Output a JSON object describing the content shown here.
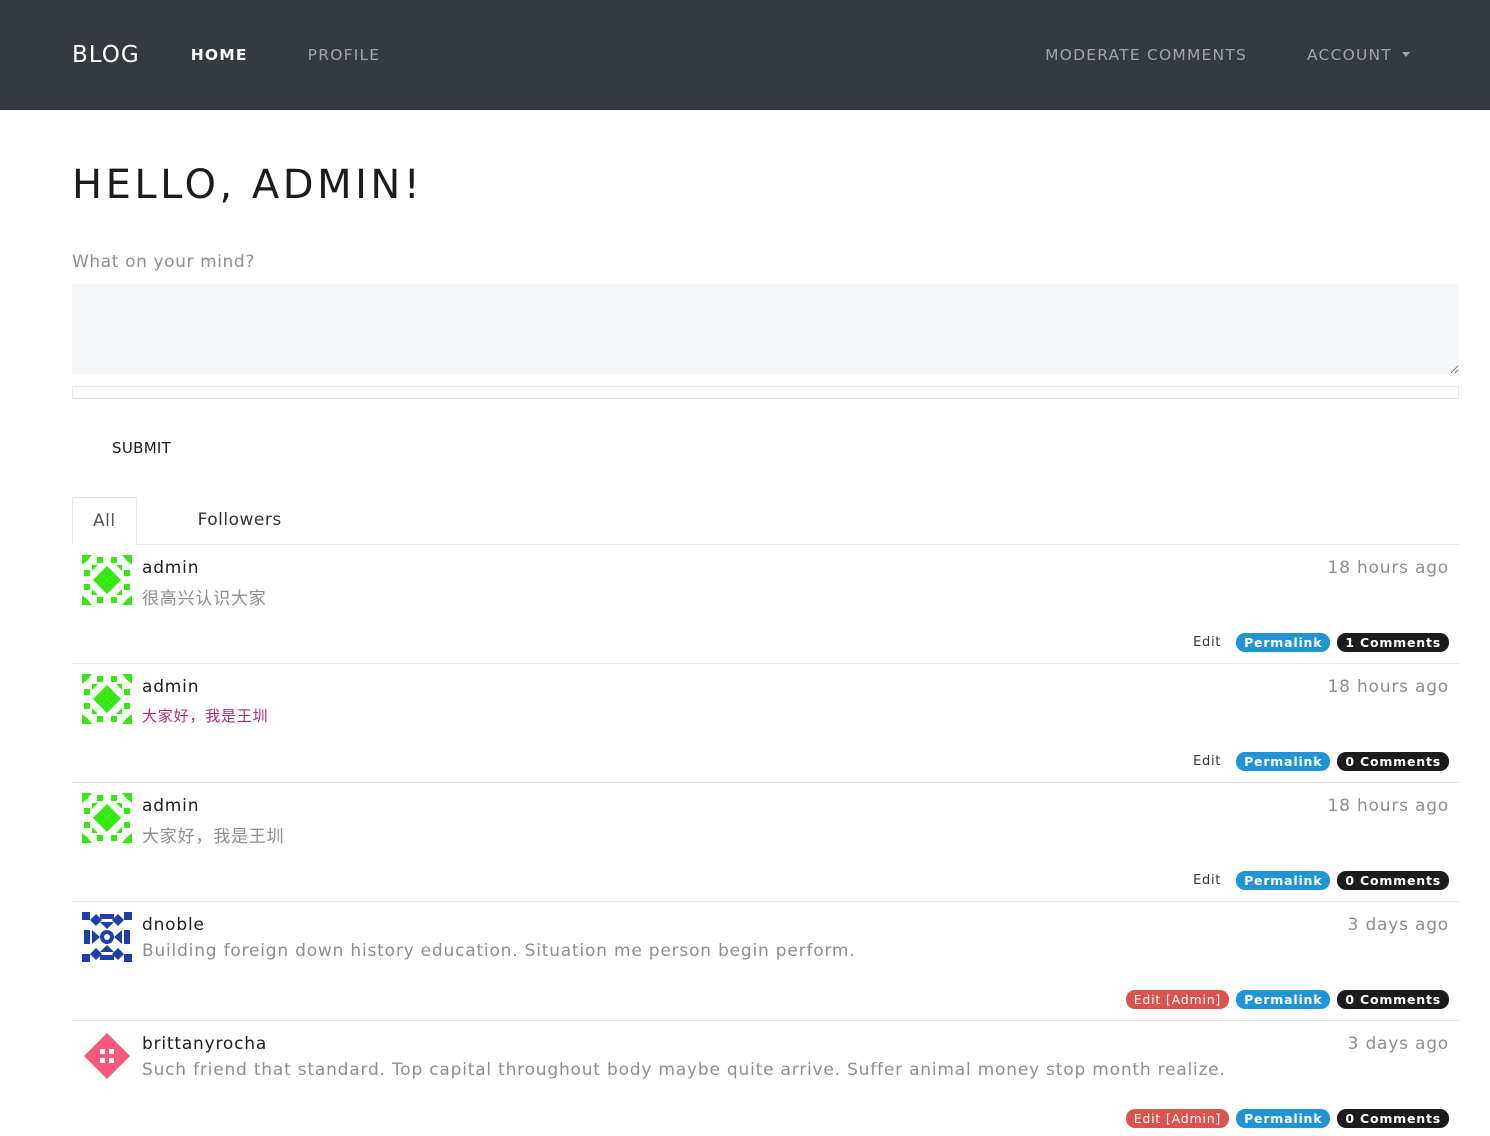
{
  "nav": {
    "brand": "BLOG",
    "home": "HOME",
    "profile": "PROFILE",
    "moderate": "MODERATE COMMENTS",
    "account": "ACCOUNT"
  },
  "greeting": "HELLO, ADMIN!",
  "form": {
    "label": "What on your mind?",
    "textarea_value": "",
    "submit": "SUBMIT"
  },
  "tabs": {
    "all": "All",
    "followers": "Followers"
  },
  "posts": [
    {
      "author": "admin",
      "body": "很高兴认识大家",
      "time": "18 hours ago",
      "edit": "Edit",
      "permalink": "Permalink",
      "comments": "1 Comments",
      "avatar": "green-pattern-avatar"
    },
    {
      "author": "admin",
      "body": "大家好，我是王圳",
      "time": "18 hours ago",
      "edit": "Edit",
      "permalink": "Permalink",
      "comments": "0 Comments",
      "avatar": "green-pattern-avatar"
    },
    {
      "author": "admin",
      "body": "大家好，我是王圳",
      "time": "18 hours ago",
      "edit": "Edit",
      "permalink": "Permalink",
      "comments": "0 Comments",
      "avatar": "green-pattern-avatar"
    },
    {
      "author": "dnoble",
      "body": "Building foreign down history education. Situation me person begin perform.",
      "time": "3 days ago",
      "edit": "Edit [Admin]",
      "permalink": "Permalink",
      "comments": "0 Comments",
      "avatar": "blue-pattern-avatar"
    },
    {
      "author": "brittanyrocha",
      "body": "Such friend that standard. Top capital throughout body maybe quite arrive. Suffer animal money stop month realize.",
      "time": "3 days ago",
      "edit": "Edit [Admin]",
      "permalink": "Permalink",
      "comments": "0 Comments",
      "avatar": "pink-diamond-avatar"
    }
  ],
  "colors": {
    "navbar": "#343a40",
    "permalink_badge": "#2194d3",
    "comments_badge": "#1c1c1e",
    "admin_edit_badge": "#d9534f",
    "accent_text": "#b0287a"
  }
}
